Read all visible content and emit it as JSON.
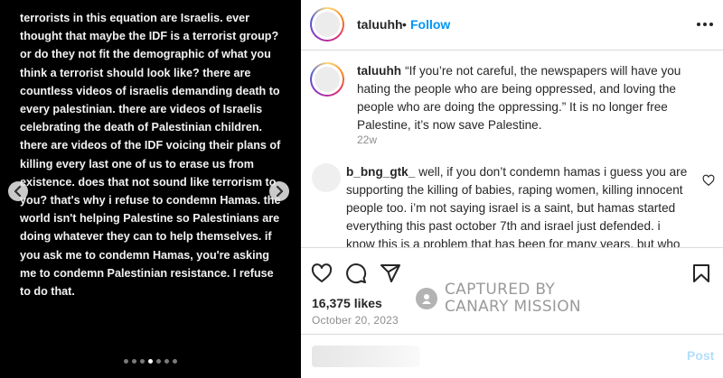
{
  "media": {
    "text": "terrorists in this equation are Israelis. ever thought that maybe the IDF is a terrorist group? or do they not fit the demographic of what you think a terrorist should look like? there are countless videos of israelis demanding death to every palestinian. there are videos of Israelis celebrating the death of Palestinian children. there are videos of the IDF voicing their plans of killing every last one of us to erase us from existence. does that not sound like terrorism to you? that's why i refuse to condemn Hamas. the world isn't helping Palestine so Palestinians are doing whatever they can to help themselves. if you ask me to condemn Hamas, you're asking me to condemn Palestinian resistance. I refuse to do that.",
    "prev_icon": "chevron-left-icon",
    "next_icon": "chevron-right-icon",
    "dot_count": 7,
    "active_dot": 3
  },
  "header": {
    "username": "taluuhh",
    "separator": "•",
    "follow_label": "Follow",
    "more_icon": "more-horizontal-icon"
  },
  "caption": {
    "username": "taluuhh",
    "text": "“If you’re not careful, the newspapers will have you hating the people who are being oppressed, and loving the people who are doing the oppressing.” It is no longer free Palestine, it’s now save Palestine.",
    "time": "22w"
  },
  "comment": {
    "username": "b_bng_gtk_",
    "text": "well, if you don’t condemn hamas i guess you are supporting the killing of babies, raping women, killing innocent people too. i’m not saying israel is a saint, but hamas started everything this past october 7th and israel just defended. i know this is a problem that has been for many years, but who started? there were all neighboring countries agains israel and",
    "like_icon": "heart-outline-icon"
  },
  "actions": {
    "like_icon": "heart-icon",
    "comment_icon": "comment-icon",
    "share_icon": "share-icon",
    "save_icon": "bookmark-icon",
    "likes": "16,375 likes",
    "date": "October 20, 2023"
  },
  "watermark": {
    "line1": "CAPTURED BY",
    "line2": "CANARY MISSION"
  },
  "add_comment": {
    "placeholder": "",
    "post_label": "Post",
    "emoji_icon": "emoji-icon"
  },
  "colors": {
    "accent": "#0095f6",
    "post_disabled": "#b2dffc",
    "media_bg": "#000000"
  }
}
